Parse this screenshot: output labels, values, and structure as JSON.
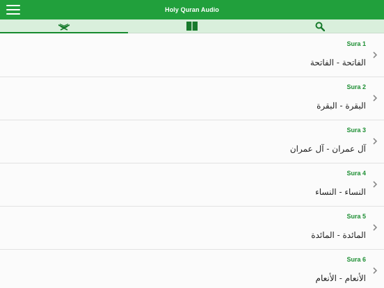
{
  "header": {
    "title": "Holy Quran Audio"
  },
  "tabs": [
    {
      "icon": "quran-stand-icon",
      "active": true
    },
    {
      "icon": "book-icon",
      "active": false
    },
    {
      "icon": "search-icon",
      "active": false
    }
  ],
  "suras": [
    {
      "number_label": "Sura 1",
      "name": "الفاتحة - الفاتحة"
    },
    {
      "number_label": "Sura 2",
      "name": "البقرة - البقرة"
    },
    {
      "number_label": "Sura 3",
      "name": "آل عمران - آل عمران"
    },
    {
      "number_label": "Sura 4",
      "name": "النساء - النساء"
    },
    {
      "number_label": "Sura 5",
      "name": "المائدة - المائدة"
    },
    {
      "number_label": "Sura 6",
      "name": "الأنعام - الأنعام"
    }
  ],
  "colors": {
    "header_bg": "#21a03c",
    "tabbar_bg": "#d9efdc",
    "accent": "#1e8f34"
  }
}
